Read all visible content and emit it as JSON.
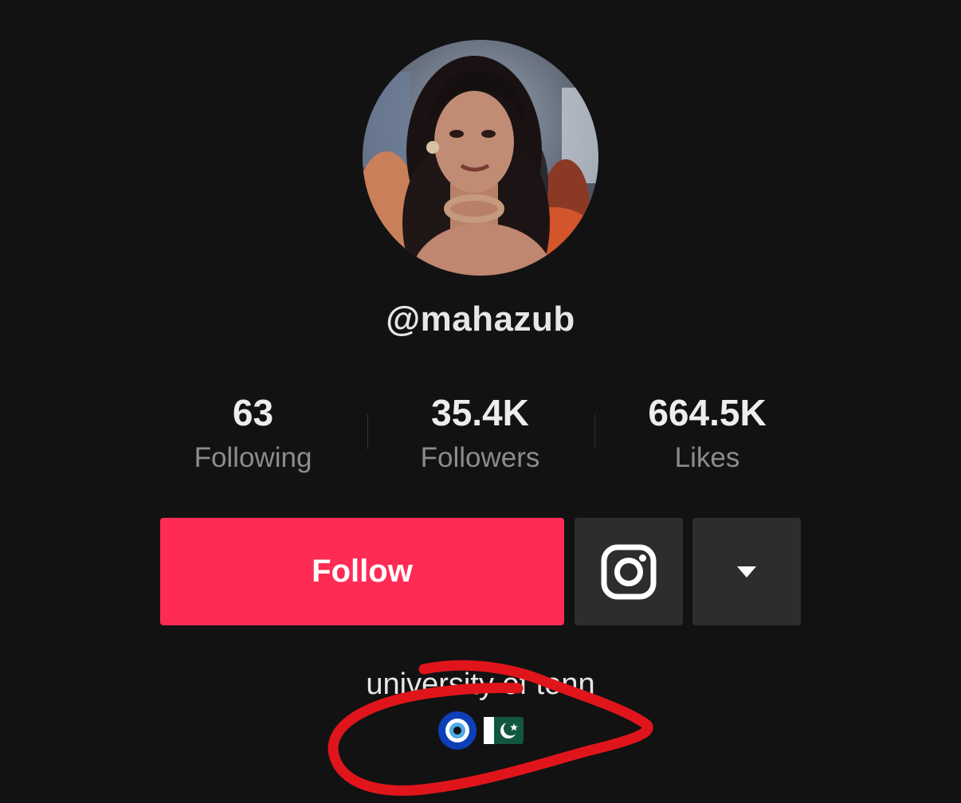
{
  "profile": {
    "username": "@mahazub",
    "avatar_icon": "profile-photo"
  },
  "stats": [
    {
      "value": "63",
      "label": "Following"
    },
    {
      "value": "35.4K",
      "label": "Followers"
    },
    {
      "value": "664.5K",
      "label": "Likes"
    }
  ],
  "actions": {
    "follow_label": "Follow",
    "follow_color": "#fe2c55",
    "instagram_icon": "instagram-icon",
    "more_icon": "caret-down-icon"
  },
  "bio": {
    "text": "university of tenn",
    "emojis": [
      "nazar-amulet-emoji",
      "pakistan-flag-emoji"
    ]
  },
  "annotation": {
    "color": "#e0151b",
    "shape": "hand-drawn-circle"
  },
  "colors": {
    "background": "#121212",
    "secondary_button": "#2d2d2d",
    "muted_text": "#8c8c8c"
  }
}
